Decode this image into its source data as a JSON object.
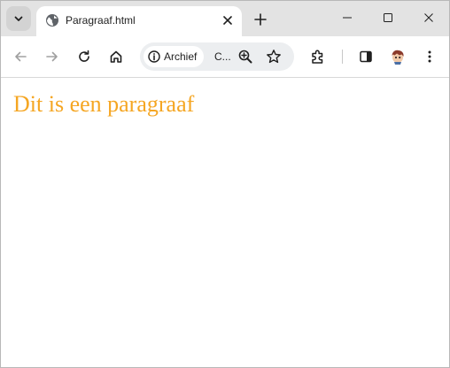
{
  "tab": {
    "title": "Paragraaf.html",
    "favicon": "globe-icon"
  },
  "window_controls": {
    "minimize": "minimize-icon",
    "maximize": "maximize-icon",
    "close": "close-icon"
  },
  "toolbar": {
    "site_chip_label": "Archief",
    "url_text": "C...",
    "icons": [
      "back-arrow-icon",
      "forward-arrow-icon",
      "reload-icon",
      "home-icon",
      "info-icon",
      "zoom-icon",
      "star-icon",
      "extensions-icon",
      "side-panel-icon",
      "avatar",
      "more-vert-icon"
    ]
  },
  "page": {
    "paragraph": "Dit is een paragraaf",
    "paragraph_color": "#f5a623"
  }
}
